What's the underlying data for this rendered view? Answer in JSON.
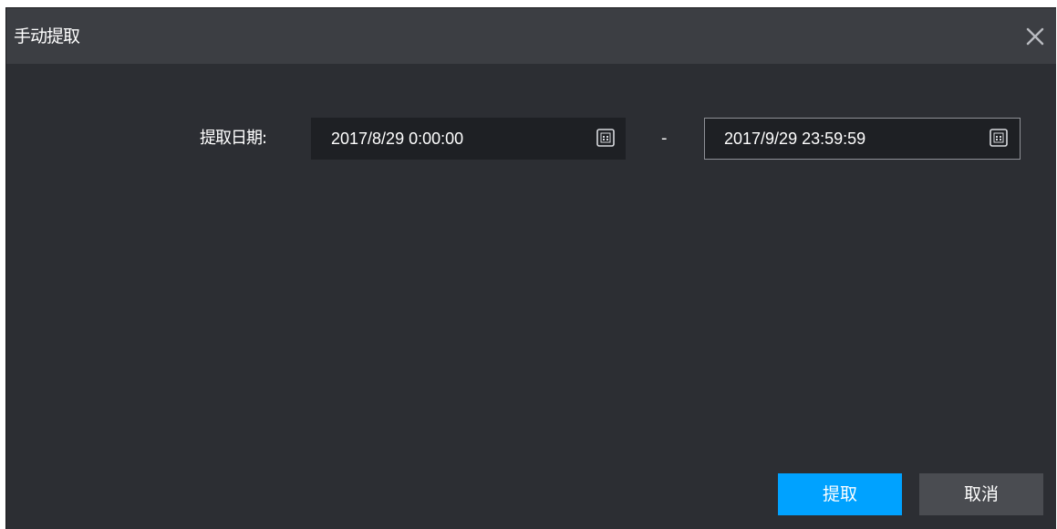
{
  "dialog": {
    "title": "手动提取"
  },
  "form": {
    "date_label": "提取日期:",
    "start_date": "2017/8/29 0:00:00",
    "separator": "-",
    "end_date": "2017/9/29 23:59:59"
  },
  "buttons": {
    "extract_label": "提取",
    "cancel_label": "取消"
  },
  "icons": {
    "close": "close-icon",
    "calendar": "calendar-icon"
  },
  "colors": {
    "primary_button": "#00a2ff",
    "dialog_bg": "#2c2e33",
    "titlebar_bg": "#3c3e43"
  }
}
